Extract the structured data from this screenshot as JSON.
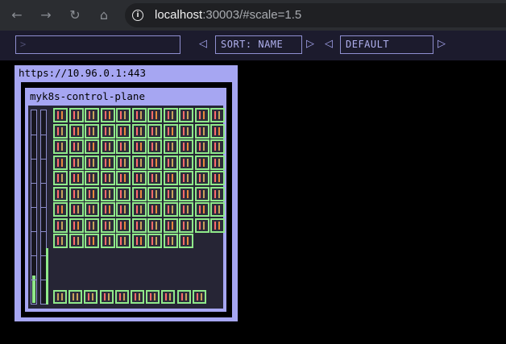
{
  "browser": {
    "url_host": "localhost",
    "url_rest": ":30003/#scale=1.5",
    "icons": [
      "back-icon",
      "forward-icon",
      "reload-icon",
      "home-icon",
      "info-icon"
    ]
  },
  "toolbar": {
    "filter_placeholder": ">",
    "sort_label": "SORT: NAME",
    "theme_label": "DEFAULT",
    "prev_glyph": "◁",
    "next_glyph": "▷"
  },
  "cluster": {
    "api_server": "https://10.96.0.1:443",
    "node_name": "myk8s-control-plane",
    "pod_count": 97,
    "system_pod_count": 10,
    "cpu_usage_fraction": 0.14,
    "memory_usage_fraction": 0.3,
    "colors": {
      "cluster_frame": "#a6a6f2",
      "node_background": "#262535",
      "pod_running": "#8fe98a",
      "container_a": "#ff6b6b",
      "container_b": "#c8a35a",
      "container_c": "#e88a3c"
    }
  }
}
